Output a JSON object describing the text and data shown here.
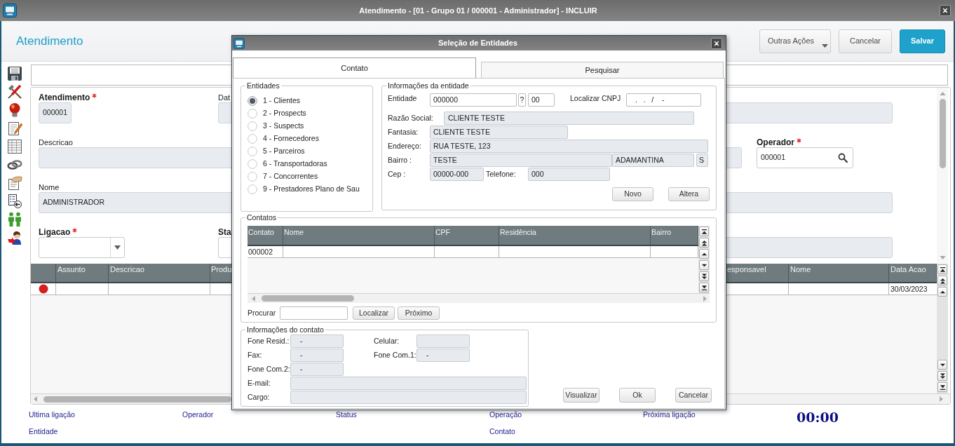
{
  "window": {
    "title": "Atendimento - [01 - Grupo 01 / 000001 - Administrador] - INCLUIR"
  },
  "header": {
    "title": "Atendimento",
    "buttons": [
      {
        "label": "Outras Ações",
        "kind": "menu"
      },
      {
        "label": "Cancelar",
        "kind": "secondary"
      },
      {
        "label": "Salvar",
        "kind": "primary"
      }
    ]
  },
  "form": {
    "rows": [
      [
        {
          "label": "Atendimento",
          "bold": true,
          "required": true,
          "value": "000001",
          "readonly": true,
          "kind": "text"
        },
        {
          "label": "Dat",
          "bold": false,
          "readonly": true,
          "kind": "text"
        },
        {
          "readonly": true,
          "kind": "text"
        }
      ],
      [
        {
          "label": "Descricao",
          "bold": false,
          "required": false,
          "readonly": true,
          "kind": "text"
        },
        {
          "readonly": true,
          "kind": "text"
        },
        {
          "label": "Operador",
          "bold": true,
          "required": true,
          "value": "000001",
          "readonly": false,
          "kind": "lookup"
        }
      ],
      [
        {
          "label": "Nome",
          "bold": false,
          "required": false,
          "value": "ADMINISTRADOR",
          "readonly": true,
          "kind": "text"
        },
        {
          "readonly": true,
          "kind": "text"
        }
      ],
      [
        {
          "label": "Ligacao",
          "bold": true,
          "required": true,
          "readonly": false,
          "kind": "select"
        },
        {
          "label": "Sta",
          "bold": true,
          "readonly": false,
          "kind": "text"
        },
        {
          "readonly": true,
          "kind": "text"
        }
      ]
    ]
  },
  "grid": {
    "columns": [
      "Assunto",
      "Descricao",
      "Produ",
      "esponsavel",
      "Nome",
      "Data Acao"
    ],
    "rows": [
      {
        "color": "#d81f1f",
        "data_acao": "30/03/2023"
      }
    ]
  },
  "footer": {
    "row_1": [
      "Ultima ligação",
      "Operador",
      "Status",
      "Operação",
      "Próxima ligação"
    ],
    "timer": "00:00",
    "row_2": [
      "Entidade",
      "Contato"
    ]
  },
  "dialog": {
    "title": "Seleção de Entidades",
    "tabs": [
      {
        "label": "Contato",
        "selected": true
      },
      {
        "label": "Pesquisar",
        "selected": false
      }
    ],
    "entities": {
      "title": "Entidades",
      "options": [
        {
          "label": "1 - Clientes",
          "selected": true
        },
        {
          "label": "2 - Prospects",
          "selected": false
        },
        {
          "label": "3 - Suspects",
          "selected": false
        },
        {
          "label": "4 - Fornecedores",
          "selected": false
        },
        {
          "label": "5 - Parceiros",
          "selected": false
        },
        {
          "label": "6 - Transportadoras",
          "selected": false
        },
        {
          "label": "7 - Concorrentes",
          "selected": false
        },
        {
          "label": "9 - Prestadores Plano de Sau",
          "selected": false
        }
      ]
    },
    "entity_info": {
      "title": "Informações da entidade",
      "entidade": {
        "label": "Entidade",
        "value": "000000",
        "help": "?",
        "branch": "00"
      },
      "cnpj": {
        "label": "Localizar CNPJ",
        "value": ".   .   /    -"
      },
      "razao_social": {
        "label": "Razão Social:",
        "value": "CLIENTE TESTE"
      },
      "fantasia": {
        "label": "Fantasia:",
        "value": "CLIENTE TESTE"
      },
      "endereco": {
        "label": "Endereço:",
        "value": "RUA TESTE, 123"
      },
      "bairro": {
        "label": "Bairro :",
        "value": "TESTE",
        "city": "ADAMANTINA",
        "state": "S"
      },
      "cep": {
        "label": "Cep :",
        "value": "00000-000"
      },
      "telefone": {
        "label": "Telefone:",
        "value": "000"
      },
      "buttons": [
        "Novo",
        "Altera"
      ]
    },
    "contacts": {
      "title": "Contatos",
      "columns": [
        "Contato",
        "Nome",
        "CPF",
        "Residência",
        "Bairro"
      ],
      "rows": [
        {
          "contato": "000002"
        }
      ],
      "search": {
        "label": "Procurar",
        "buttons": [
          "Localizar",
          "Próximo"
        ]
      }
    },
    "contact_info": {
      "title": "Informações do contato",
      "fone_resid": {
        "label": "Fone Resid.:",
        "value": "-"
      },
      "celular": {
        "label": "Celular:"
      },
      "fax": {
        "label": "Fax:",
        "value": "-"
      },
      "fone_com_1": {
        "label": "Fone Com.1:",
        "value": "-"
      },
      "fone_com_2": {
        "label": "Fone Com.2:",
        "value": "-"
      },
      "email": {
        "label": "E-mail:"
      },
      "cargo": {
        "label": "Cargo:"
      }
    },
    "buttons": [
      "Visualizar",
      "Ok",
      "Cancelar"
    ]
  }
}
